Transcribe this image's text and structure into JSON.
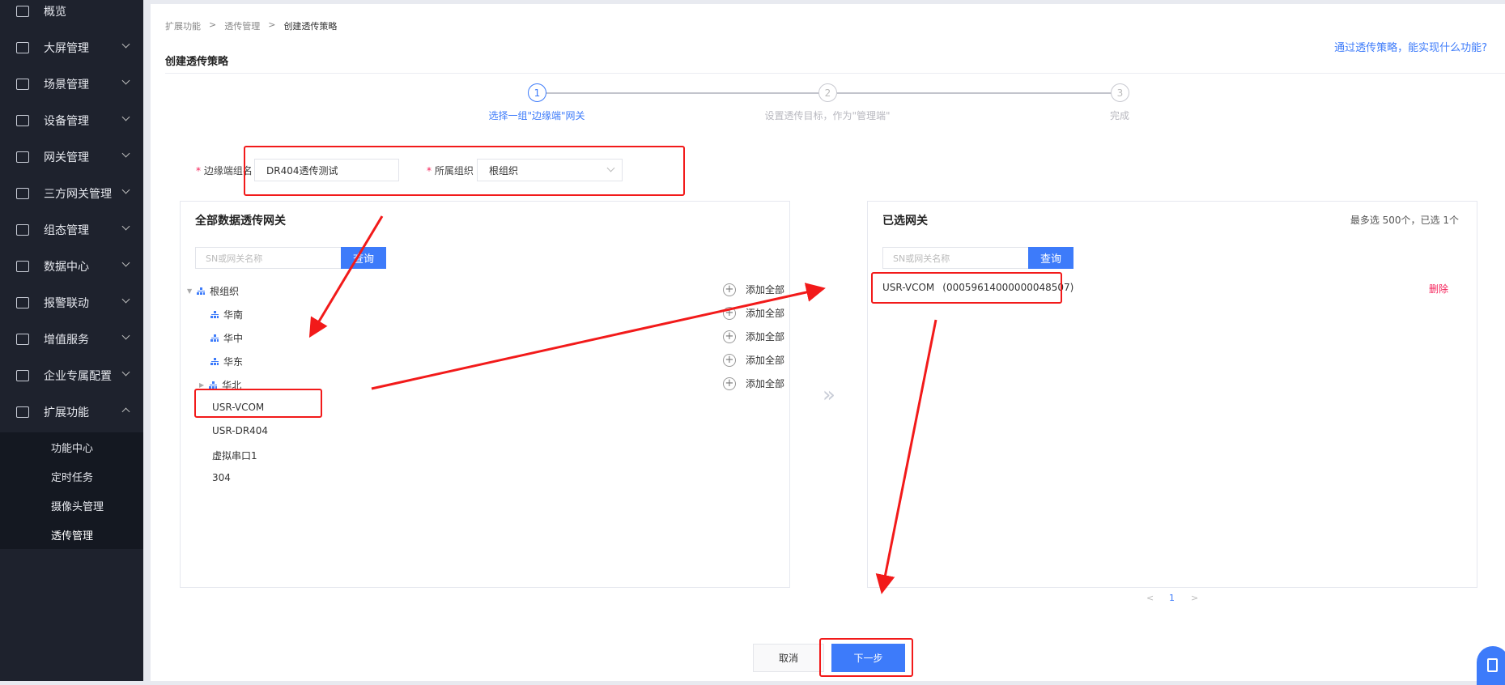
{
  "sidebar": {
    "items": [
      {
        "label": "概览",
        "icon": "overview-icon",
        "expandable": false
      },
      {
        "label": "大屏管理",
        "icon": "monitor-icon",
        "expandable": true
      },
      {
        "label": "场景管理",
        "icon": "cube-icon",
        "expandable": true
      },
      {
        "label": "设备管理",
        "icon": "device-icon",
        "expandable": true
      },
      {
        "label": "网关管理",
        "icon": "gateway-icon",
        "expandable": true
      },
      {
        "label": "三方网关管理",
        "icon": "third-party-icon",
        "expandable": true
      },
      {
        "label": "组态管理",
        "icon": "topology-icon",
        "expandable": true
      },
      {
        "label": "数据中心",
        "icon": "chart-icon",
        "expandable": true
      },
      {
        "label": "报警联动",
        "icon": "alarm-icon",
        "expandable": true
      },
      {
        "label": "增值服务",
        "icon": "diamond-icon",
        "expandable": true
      },
      {
        "label": "企业专属配置",
        "icon": "building-icon",
        "expandable": true
      },
      {
        "label": "扩展功能",
        "icon": "grid-icon",
        "expandable": true,
        "expanded": true
      }
    ],
    "submenu": [
      "功能中心",
      "定时任务",
      "摄像头管理",
      "透传管理"
    ]
  },
  "breadcrumb": [
    "扩展功能",
    "透传管理",
    "创建透传策略"
  ],
  "page_title": "创建透传策略",
  "help_link": "通过透传策略，能实现什么功能?",
  "steps": [
    {
      "num": "1",
      "label": "选择一组\"边缘端\"网关",
      "active": true
    },
    {
      "num": "2",
      "label": "设置透传目标，作为\"管理端\""
    },
    {
      "num": "3",
      "label": "完成"
    }
  ],
  "form": {
    "group_label": "边缘端组名",
    "group_value": "DR404透传测试",
    "org_label": "所属组织",
    "org_value": "根组织",
    "required": "*"
  },
  "left": {
    "title": "全部数据透传网关",
    "search_placeholder": "SN或网关名称",
    "query": "查询",
    "add_all": "添加全部",
    "root": "根组织",
    "children": [
      "华南",
      "华中",
      "华东",
      "华北"
    ],
    "gateways": [
      "USR-VCOM",
      "USR-DR404",
      "虚拟串口1",
      "304"
    ]
  },
  "transfer_icon": "»",
  "right": {
    "title": "已选网关",
    "limit": "最多选 500个，已选 1个",
    "search_placeholder": "SN或网关名称",
    "query": "查询",
    "selected": [
      {
        "name": "USR-VCOM",
        "sn": "(00059614000000048507)",
        "action": "删除"
      }
    ],
    "page": "1"
  },
  "buttons": {
    "cancel": "取消",
    "next": "下一步"
  },
  "colors": {
    "accent": "#3d7bfa",
    "annotation": "#f21a1a",
    "danger": "#f5225a",
    "sidebar": "#1e222d"
  }
}
